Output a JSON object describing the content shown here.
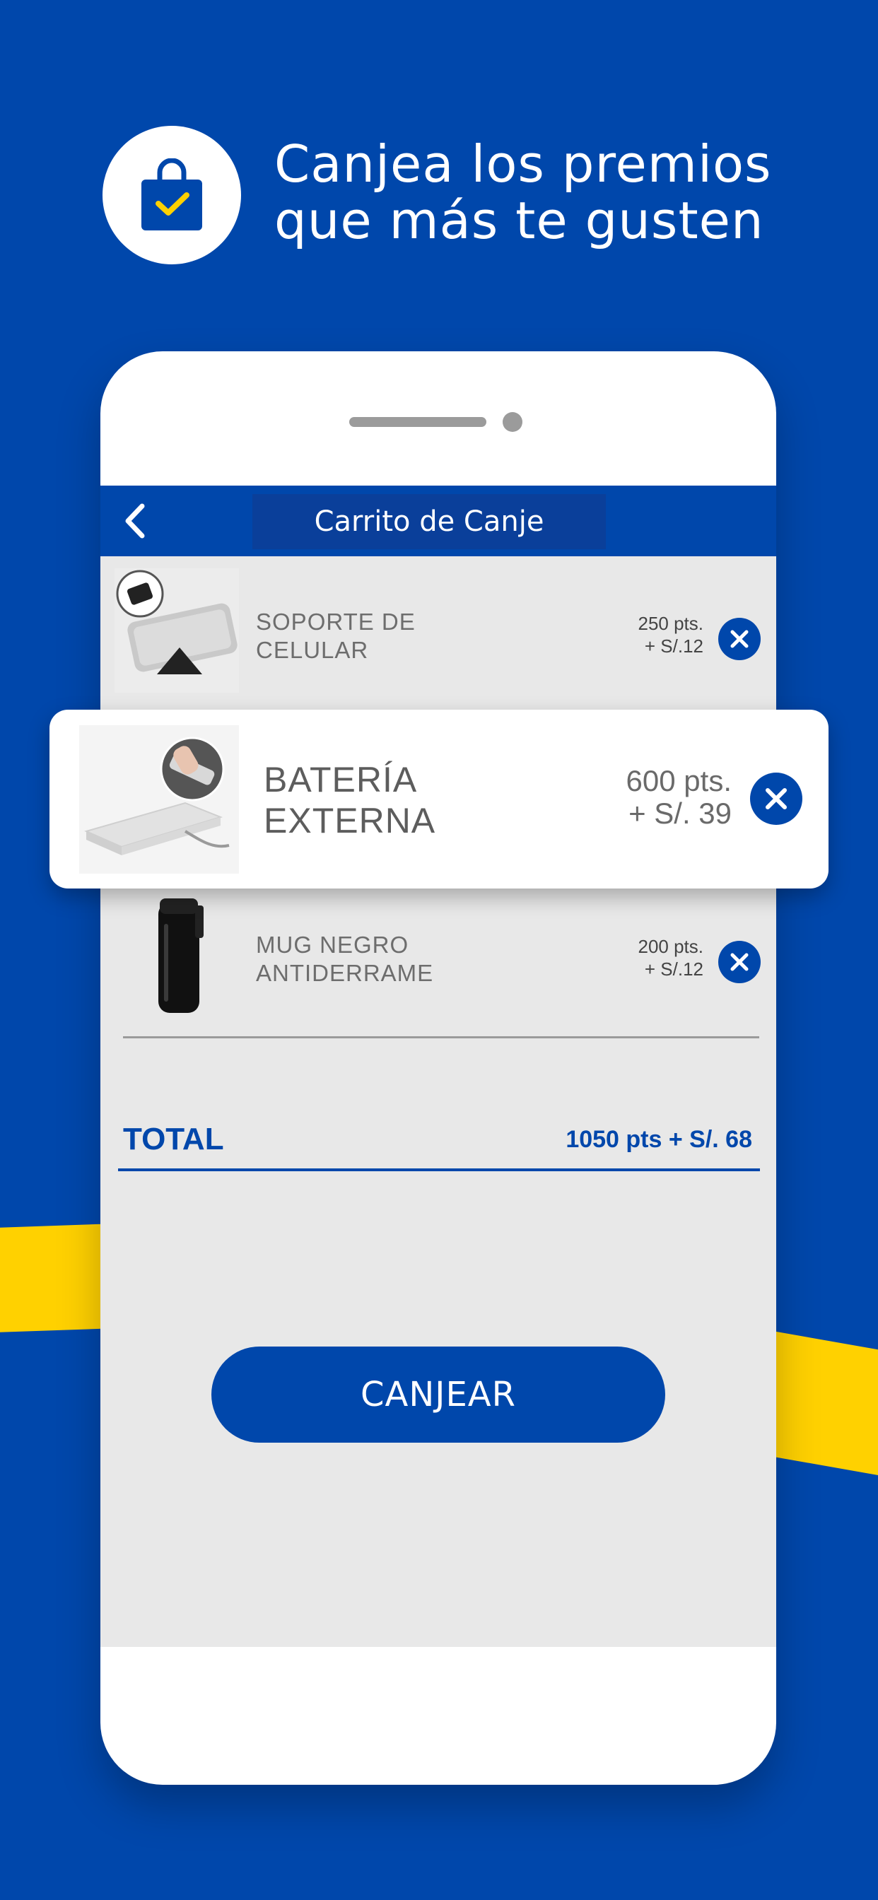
{
  "colors": {
    "brand_blue": "#0047AB",
    "accent_yellow": "#FFD100",
    "screen_bg": "#E8E8E8"
  },
  "header": {
    "icon": "shopping-bag-check-icon",
    "line1": "Canjea los premios",
    "line2": "que más te gusten"
  },
  "app": {
    "navbar": {
      "back_icon": "chevron-left-icon",
      "title": "Carrito de Canje"
    },
    "items": [
      {
        "name_line1": "SOPORTE DE",
        "name_line2": "CELULAR",
        "price_line1": "250 pts.",
        "price_line2": "+ S/.12",
        "remove_icon": "close-icon"
      },
      {
        "name_line1": "BATERÍA",
        "name_line2": "EXTERNA",
        "price_line1": "600 pts.",
        "price_line2": "+ S/. 39",
        "remove_icon": "close-icon"
      },
      {
        "name_line1": "MUG NEGRO",
        "name_line2": "ANTIDERRAME",
        "price_line1": "200 pts.",
        "price_line2": "+ S/.12",
        "remove_icon": "close-icon"
      }
    ],
    "total": {
      "label": "TOTAL",
      "value": "1050 pts + S/. 68"
    },
    "redeem_button": "CANJEAR"
  }
}
